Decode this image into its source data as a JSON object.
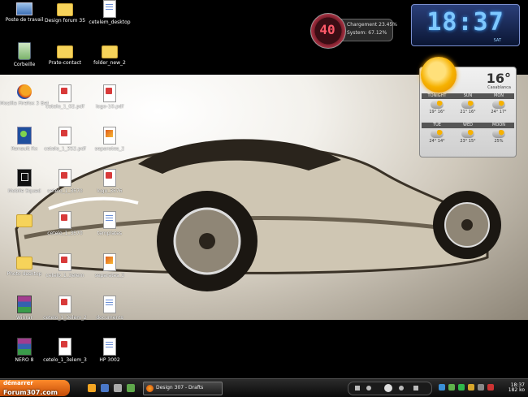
{
  "desktop": {
    "icons": [
      {
        "label": "Poste de travail",
        "type": "computer"
      },
      {
        "label": "Design forum 35",
        "type": "folder"
      },
      {
        "label": "cetelem_desktop",
        "type": "doc"
      },
      {
        "label": "Corbeille",
        "type": "trash"
      },
      {
        "label": "Prate-contact",
        "type": "folder"
      },
      {
        "label": "folder_new_2",
        "type": "folder"
      },
      {
        "label": "Mozilla Firefox 3 Beta",
        "type": "firefox"
      },
      {
        "label": "cetelo_1_02.pdf",
        "type": "pdf"
      },
      {
        "label": "logo-10.pdf",
        "type": "pdf"
      },
      {
        "label": "Renault Rx",
        "type": "app"
      },
      {
        "label": "cetelo_1_352.pdf",
        "type": "pdf"
      },
      {
        "label": "separates_2",
        "type": "img"
      },
      {
        "label": "Mobile Squad",
        "type": "dark"
      },
      {
        "label": "cetelo_1_3570",
        "type": "pdf"
      },
      {
        "label": "logo_3576",
        "type": "pdf"
      },
      {
        "label": "",
        "type": "folder"
      },
      {
        "label": "cetelo_1_3570",
        "type": "pdf"
      },
      {
        "label": "templates",
        "type": "doc"
      },
      {
        "label": "Photo desktop",
        "type": "folder"
      },
      {
        "label": "cetelo_1_3elem",
        "type": "pdf"
      },
      {
        "label": "separates_3",
        "type": "img"
      },
      {
        "label": "Winrar",
        "type": "rar"
      },
      {
        "label": "cetelo_1_3elem_2",
        "type": "pdf"
      },
      {
        "label": "documents",
        "type": "doc"
      },
      {
        "label": "NERO 8",
        "type": "rar"
      },
      {
        "label": "cetelo_1_3elem_3",
        "type": "pdf"
      },
      {
        "label": "HP 3002",
        "type": "doc"
      }
    ]
  },
  "cpu_gadget": {
    "value": "40",
    "line1": "Chargement 23.45%",
    "line2": "System: 67.12%"
  },
  "clock_gadget": {
    "time": "18:37",
    "day": "SAT"
  },
  "weather_gadget": {
    "temperature": "16°",
    "city": "Casablanca",
    "forecast": [
      {
        "day": "TONIGHT",
        "temps": "19° 16°"
      },
      {
        "day": "SUN",
        "temps": "21° 16°"
      },
      {
        "day": "MON",
        "temps": "24° 17°"
      },
      {
        "day": "TUE",
        "temps": "24° 14°"
      },
      {
        "day": "WED",
        "temps": "23° 15°"
      },
      {
        "day": "MOON",
        "temps": "25%"
      }
    ]
  },
  "taskbar": {
    "start_label": "démarrer",
    "watermark": "Forum307.com",
    "task_item_label": "Design 307 - Drafts",
    "tray_time": "18:37",
    "tray_kb": "182 ko"
  },
  "colors": {
    "accent": "#ff8a2b",
    "clock_text": "#7ec8ff",
    "cpu_text": "#ff5a6a"
  }
}
